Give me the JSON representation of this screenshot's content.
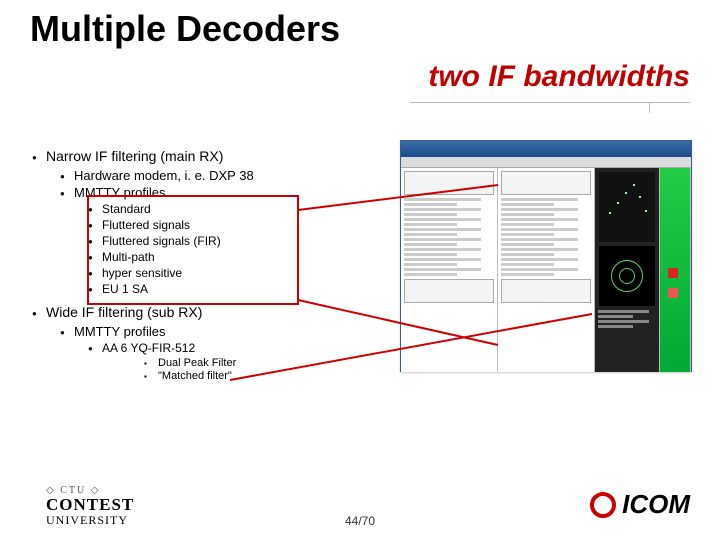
{
  "title": "Multiple Decoders",
  "subtitle": "two IF bandwidths",
  "bullets": {
    "narrow": "Narrow IF filtering (main RX)",
    "narrow_sub": {
      "hw": "Hardware modem, i. e. DXP 38",
      "mmtty": "MMTTY profiles",
      "profiles": [
        "Standard",
        "Fluttered signals",
        "Fluttered signals (FIR)",
        "Multi-path",
        "hyper sensitive",
        "EU 1 SA"
      ]
    },
    "wide": "Wide IF filtering (sub RX)",
    "wide_sub": {
      "mmtty": "MMTTY profiles",
      "aa6yq": "AA 6 YQ-FIR-512",
      "filters": [
        "Dual Peak Filter",
        "\"Matched filter\""
      ]
    }
  },
  "page": "44/70",
  "logos": {
    "ctu_top": "◇ CTU ◇",
    "ctu_mid": "CONTEST",
    "ctu_bot": "UNIVERSITY",
    "icom": "ICOM"
  }
}
